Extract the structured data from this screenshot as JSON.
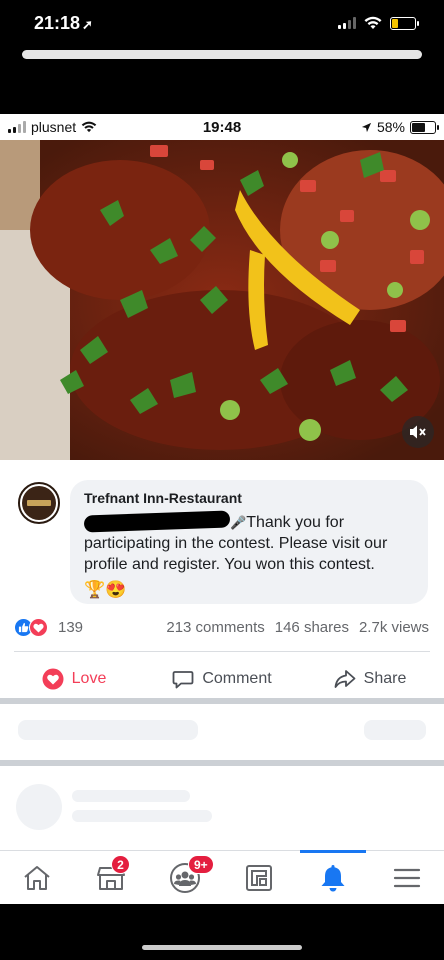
{
  "outer_status": {
    "time": "21:18"
  },
  "inner_status": {
    "carrier": "plusnet",
    "time": "19:48",
    "battery": "58%"
  },
  "comment": {
    "author": "Trefnant Inn-Restaurant",
    "text_part1": "Thank you for participating in the contest. Please visit our profile and register. You won this contest.",
    "emojis": "🏆😍"
  },
  "reactions": {
    "count": "139"
  },
  "stats": {
    "comments": "213 comments",
    "shares": "146 shares",
    "views": "2.7k views"
  },
  "actions": {
    "love": "Love",
    "comment": "Comment",
    "share": "Share"
  },
  "tabbar": {
    "marketplace_badge": "2",
    "groups_badge": "9+",
    "active_tab": "notifications"
  },
  "colors": {
    "accent": "#1877f2",
    "love": "#f33e58",
    "badge": "#e41e3f"
  },
  "icons": [
    "home-icon",
    "marketplace-icon",
    "groups-icon",
    "pages-icon",
    "bell-icon",
    "menu-icon",
    "mute-icon",
    "like-reaction-icon",
    "love-reaction-icon",
    "comment-icon",
    "share-icon"
  ]
}
